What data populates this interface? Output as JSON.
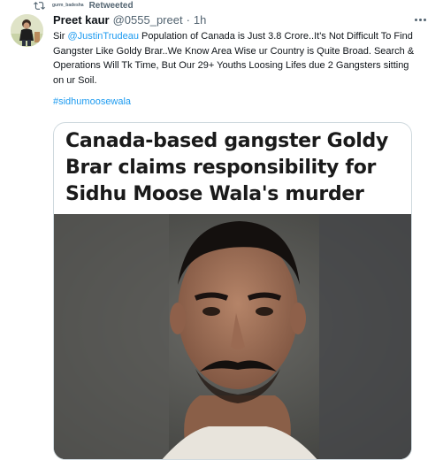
{
  "retweet": {
    "user": "gurm_badesha",
    "label": "Retweeted"
  },
  "tweet": {
    "display_name": "Preet kaur",
    "handle": "@0555_preet",
    "separator": "·",
    "time": "1h",
    "text_before_mention": "Sir ",
    "mention": "@JustinTrudeau",
    "text_after_mention": " Population of Canada is Just 3.8 Crore..It's Not Difficult To Find Gangster Like Goldy Brar..We Know Area Wise ur Country is Quite Broad. Search & Operations Will Tk Time, But Our 29+ Youths Loosing Lifes due 2 Gangsters sitting on ur Soil.",
    "hashtag": "#sidhumoosewala"
  },
  "media": {
    "headline": "Canada-based gangster Goldy Brar claims responsibility for Sidhu Moose Wala's murder"
  },
  "icons": {
    "retweet": "retweet-icon",
    "more": "more-icon",
    "avatar": "avatar"
  },
  "colors": {
    "link": "#1d9bf0",
    "secondary_text": "#536471",
    "primary_text": "#0f1419",
    "card_border": "#cfd9de"
  }
}
